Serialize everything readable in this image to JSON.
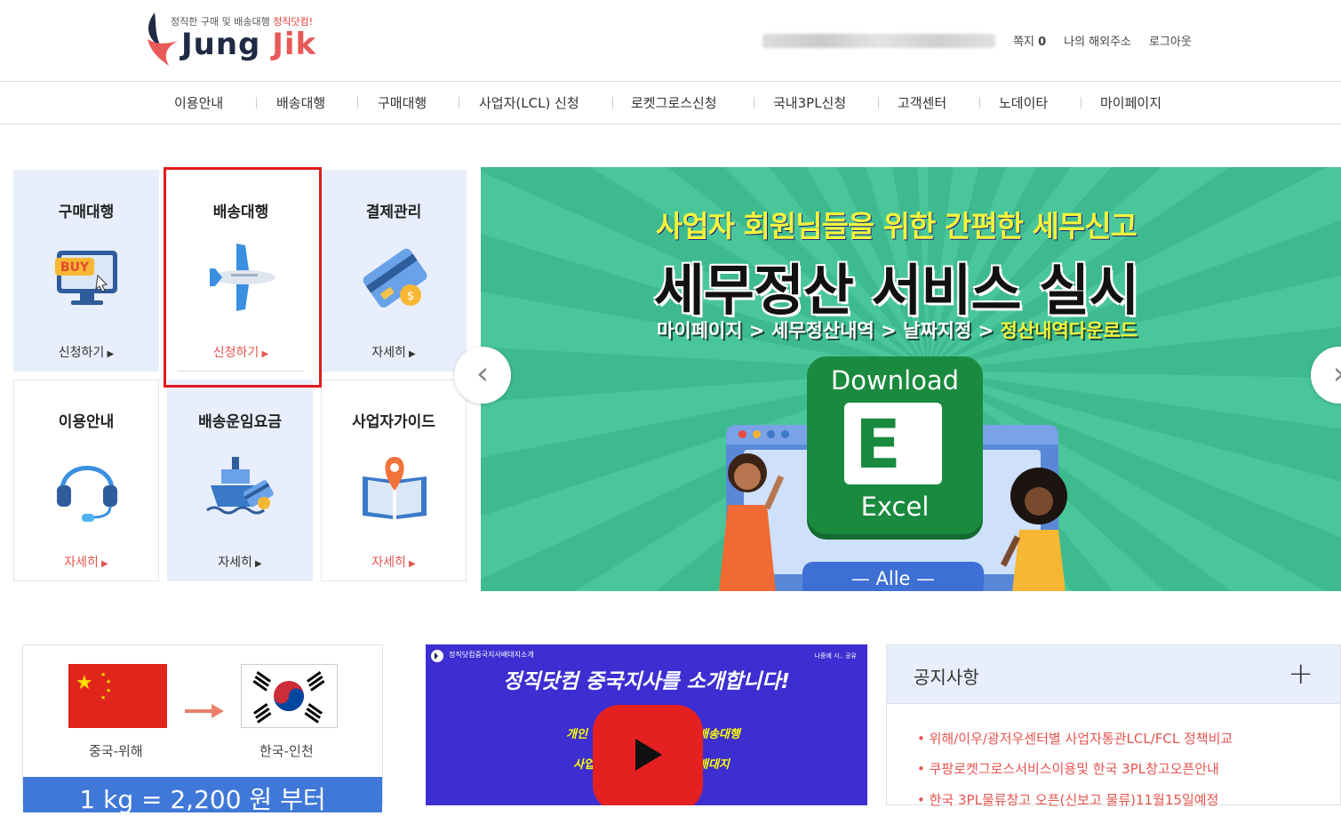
{
  "header": {
    "logo_tagline": "정직한 구매 및 배송대행 ",
    "logo_tagline_brand": "정직닷컴!",
    "logo_name_part1": "Jung ",
    "logo_name_part2": "Jik",
    "links": {
      "message_label": "쪽지",
      "message_count": "0",
      "my_address": "나의 해외주소",
      "logout": "로그아웃"
    }
  },
  "nav": [
    "이용안내",
    "배송대행",
    "구매대행",
    "사업자(LCL) 신청",
    "로켓그로스신청",
    "국내3PL신청",
    "고객센터",
    "노데이타",
    "마이페이지"
  ],
  "tiles": [
    {
      "title": "구매대행",
      "link": "신청하기",
      "icon": "buy-monitor-icon"
    },
    {
      "title": "배송대행",
      "link": "신청하기",
      "icon": "airplane-icon"
    },
    {
      "title": "결제관리",
      "link": "자세히",
      "icon": "credit-card-icon"
    },
    {
      "title": "이용안내",
      "link": "자세히",
      "icon": "headset-icon"
    },
    {
      "title": "배송운임요금",
      "link": "자세히",
      "icon": "ship-card-icon"
    },
    {
      "title": "사업자가이드",
      "link": "자세히",
      "icon": "map-book-icon"
    }
  ],
  "banner": {
    "subtitle": "사업자 회원님들을 위한 간편한 세무신고",
    "title": "세무정산 서비스 실시",
    "path_1": "마이페이지",
    "path_2": "세무정산내역",
    "path_3": "날짜지정",
    "path_4": "정산내역다운로드",
    "separator": ">",
    "download_label": "Download",
    "excel_label": "Excel",
    "excel_letter": "E",
    "bottom_button": "Alle",
    "prev_arrow": "‹",
    "next_arrow": "›"
  },
  "route": {
    "from": "중국-위해",
    "to": "한국-인천",
    "price": "1 kg = 2,200 원 부터"
  },
  "video": {
    "channel_title": "정직닷컴중국지사배대지소개",
    "headline": "정직닷컴 중국지사를 소개합니다!",
    "line1_left": "개인",
    "line1_right": "배송대행",
    "line2_left": "사업",
    "line2_right": "배대지",
    "side_label": "나중에 시..  공유"
  },
  "notice": {
    "title": "공지사항",
    "plus": "+",
    "items": [
      "위해/이우/광저우센터별 사업자통관LCL/FCL 정책비교",
      "쿠팡로켓그로스서비스이용및 한국 3PL창고오픈안내",
      "한국 3PL물류창고 오픈(신보고 물류)11월15일예정"
    ]
  },
  "colors": {
    "accent_red": "#e6544f",
    "brand_navy": "#1f2a44",
    "tile_blue": "#e8eefb",
    "banner_green": "#3dba8e",
    "highlight_red": "#e01b1b"
  }
}
